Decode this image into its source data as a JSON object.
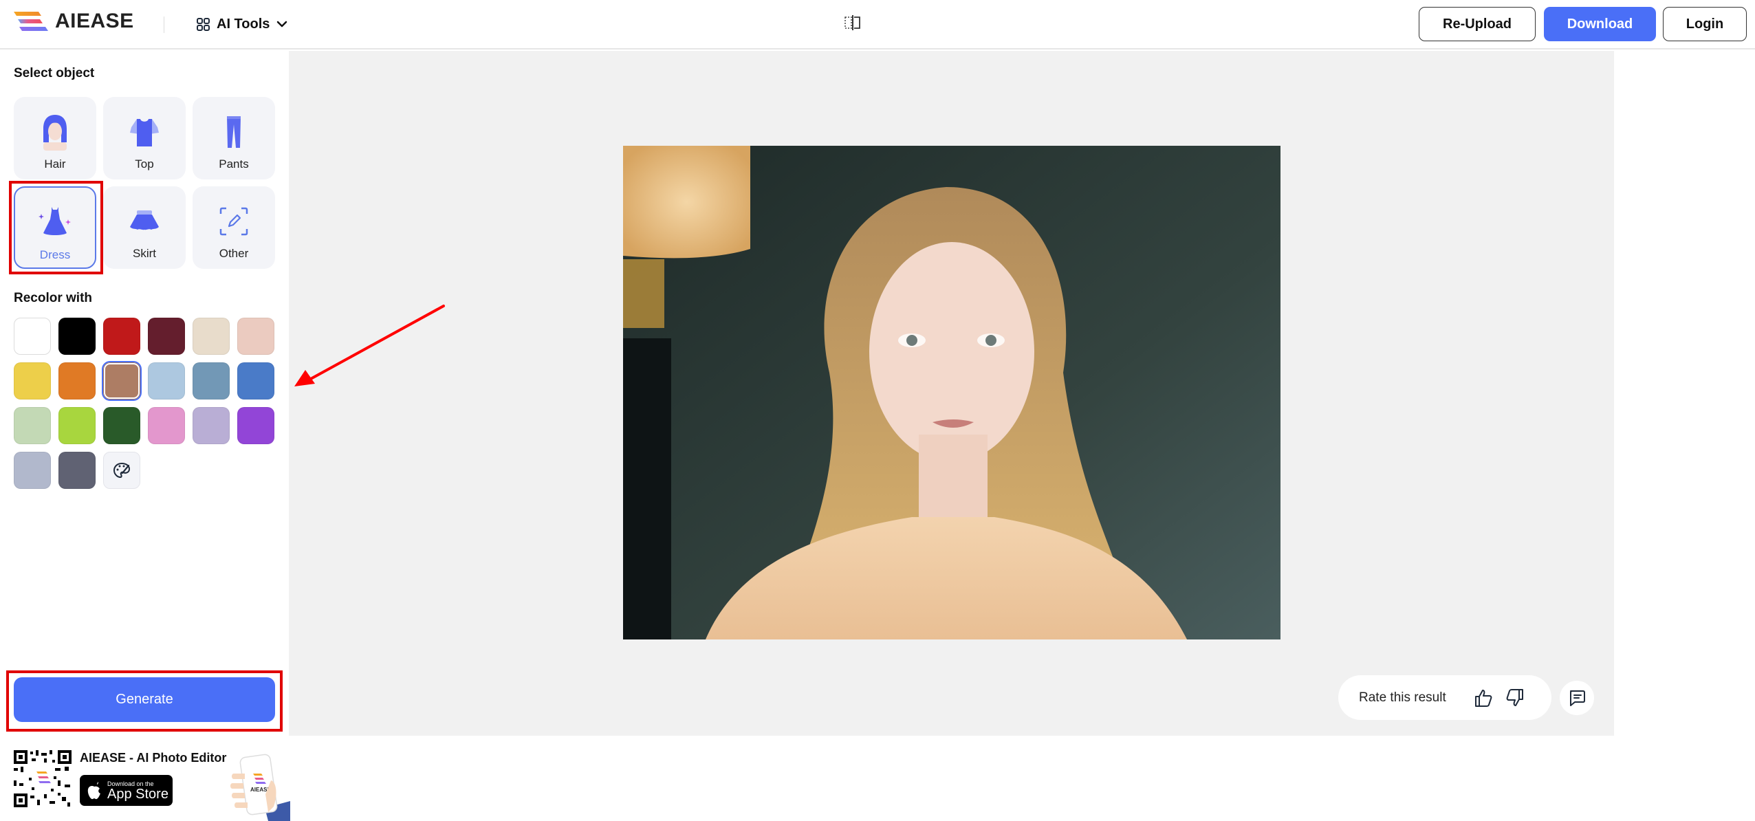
{
  "header": {
    "brand": "AIEASE",
    "ai_tools_label": "AI Tools",
    "compare_icon": "compare-split-icon",
    "reupload_label": "Re-Upload",
    "download_label": "Download",
    "login_label": "Login"
  },
  "sidebar": {
    "select_object_title": "Select object",
    "objects": [
      {
        "label": "Hair",
        "icon": "hair-icon",
        "selected": false
      },
      {
        "label": "Top",
        "icon": "top-shirt-icon",
        "selected": false
      },
      {
        "label": "Pants",
        "icon": "pants-icon",
        "selected": false
      },
      {
        "label": "Dress",
        "icon": "dress-icon",
        "selected": true
      },
      {
        "label": "Skirt",
        "icon": "skirt-icon",
        "selected": false
      },
      {
        "label": "Other",
        "icon": "edit-select-icon",
        "selected": false
      }
    ],
    "recolor_title": "Recolor with",
    "swatches": [
      {
        "color": "#ffffff",
        "selected": false
      },
      {
        "color": "#000000",
        "selected": false
      },
      {
        "color": "#c0191a",
        "selected": false
      },
      {
        "color": "#641e2d",
        "selected": false
      },
      {
        "color": "#e8dccb",
        "selected": false
      },
      {
        "color": "#ebcbc0",
        "selected": false
      },
      {
        "color": "#edcf4a",
        "selected": false
      },
      {
        "color": "#e07a25",
        "selected": false
      },
      {
        "color": "#ad7d64",
        "selected": true
      },
      {
        "color": "#adc8e0",
        "selected": false
      },
      {
        "color": "#7298b6",
        "selected": false
      },
      {
        "color": "#4a7bc8",
        "selected": false
      },
      {
        "color": "#c3d9b5",
        "selected": false
      },
      {
        "color": "#a8d63e",
        "selected": false
      },
      {
        "color": "#295a29",
        "selected": false
      },
      {
        "color": "#e397cd",
        "selected": false
      },
      {
        "color": "#b9aed5",
        "selected": false
      },
      {
        "color": "#9245d7",
        "selected": false
      },
      {
        "color": "#b1b8cc",
        "selected": false
      },
      {
        "color": "#606273",
        "selected": false
      }
    ],
    "custom_color_icon": "palette-icon",
    "generate_label": "Generate"
  },
  "canvas": {
    "image_alt": "Portrait of a young woman with long blonde hair wearing a peach blouse"
  },
  "rating": {
    "label": "Rate this result",
    "thumbs_up_icon": "thumbs-up-icon",
    "thumbs_down_icon": "thumbs-down-icon",
    "feedback_icon": "chat-feedback-icon"
  },
  "promo": {
    "title": "AIEASE - AI Photo Editor",
    "appstore_small": "Download on the",
    "appstore_big": "App Store",
    "phone_brand": "AIEASE"
  },
  "annotations": {
    "accent_red": "#e00000",
    "accent_blue": "#4a6ff7"
  }
}
